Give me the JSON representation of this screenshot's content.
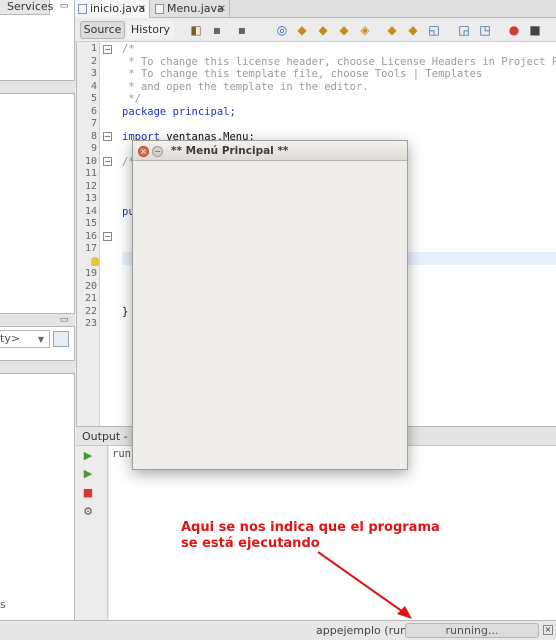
{
  "left_panel": {
    "tab_label": "Services",
    "combo_text": "ty>",
    "bottom_text": "s"
  },
  "editor_tabs": [
    {
      "label": "inicio.java",
      "close": "×"
    },
    {
      "label": "Menu.java",
      "close": "×"
    }
  ],
  "toolbar": {
    "source_label": "Source",
    "history_label": "History"
  },
  "gutter": {
    "line_numbers": [
      "1",
      "2",
      "3",
      "4",
      "5",
      "6",
      "7",
      "8",
      "9",
      "10",
      "11",
      "12",
      "13",
      "14",
      "15",
      "16",
      "17",
      "18",
      "19",
      "20",
      "21",
      "22",
      "23"
    ]
  },
  "code": {
    "l1": "/*",
    "l2": " * To change this license header, choose License Headers in Project Pr",
    "l3": " * To change this template file, choose Tools | Templates",
    "l4": " * and open the template in the editor.",
    "l5": " */",
    "l6": "package principal;",
    "l8_kw": "import",
    "l8_rest": " ventanas.Menu;",
    "l10": "/*",
    "l14": "pu",
    "l22": "}"
  },
  "output": {
    "tab_label": "Output - a",
    "run_text": "run"
  },
  "status": {
    "process": "appejemplo (run)",
    "progress": "running..."
  },
  "app_window": {
    "title": "** Menú Principal **"
  },
  "annotation": {
    "line1": "Aqui se nos indica que el programa",
    "line2": "se está ejecutando",
    "color": "#e01414"
  }
}
